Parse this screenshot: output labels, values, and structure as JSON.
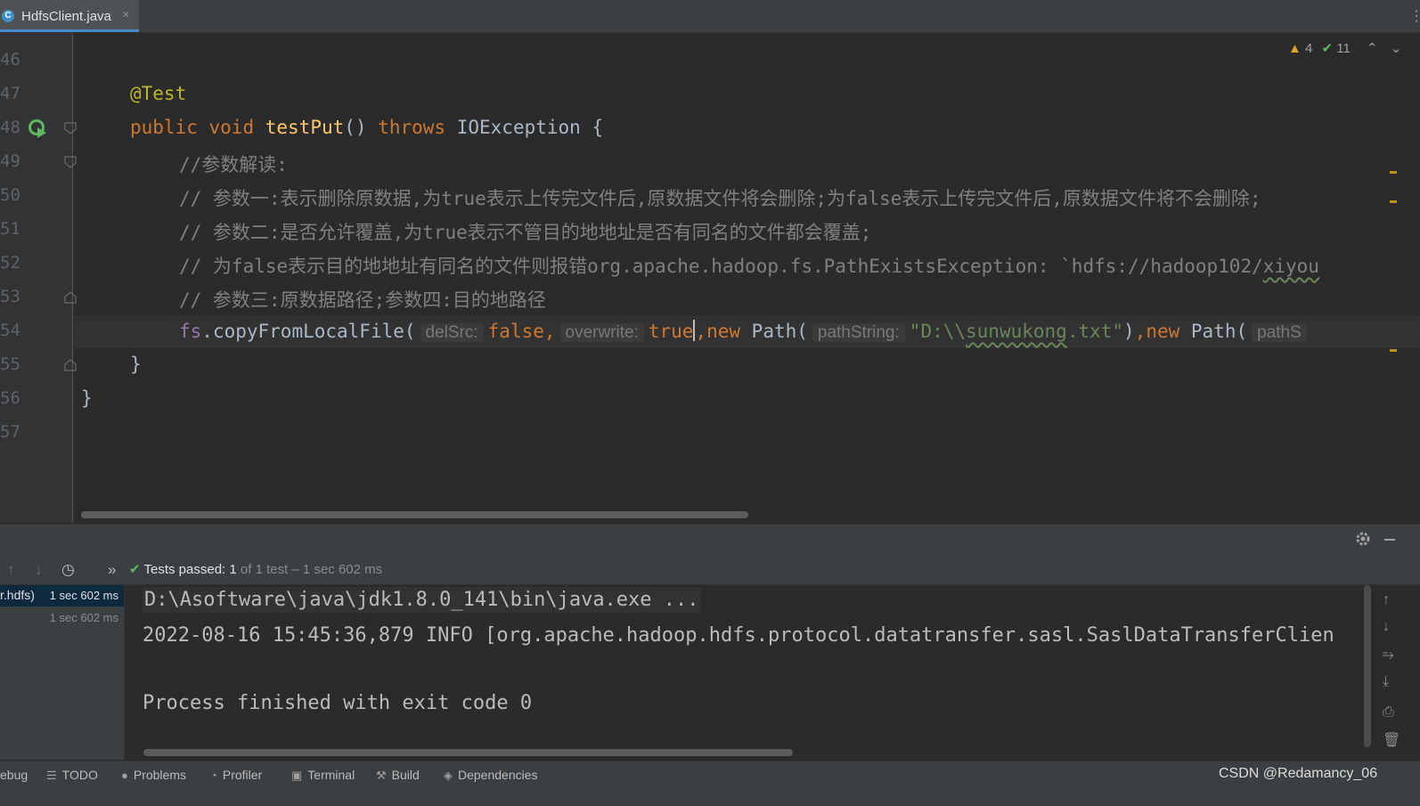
{
  "tab": {
    "filename": "HdfsClient.java",
    "icon_letter": "C",
    "close": "×"
  },
  "inspections": {
    "warnings": "4",
    "passed": "11"
  },
  "line_numbers": [
    "46",
    "47",
    "48",
    "49",
    "50",
    "51",
    "52",
    "53",
    "54",
    "55",
    "56",
    "57"
  ],
  "code": {
    "annotation": "@Test",
    "public": "public",
    "void": "void",
    "method_name": "testPut",
    "parens": "()",
    "throws": "throws",
    "exception": "IOException",
    "open_brace": "{",
    "comment_1": "//参数解读:",
    "comment_2": "// 参数一:表示删除原数据,为true表示上传完文件后,原数据文件将会删除;为false表示上传完文件后,原数据文件将不会删除;",
    "comment_3": "// 参数二:是否允许覆盖,为true表示不管目的地地址是否有同名的文件都会覆盖;",
    "comment_4": "// 为false表示目的地地址有同名的文件则报错org.apache.hadoop.fs.PathExistsException: `hdfs://hadoop102/",
    "comment_4_tail": "xiyou",
    "comment_5": "// 参数三:原数据路径;参数四:目的地路径",
    "call_obj": "fs",
    "call_method": ".copyFromLocalFile(",
    "hint_delsrc": "delSrc:",
    "val_false": "false,",
    "hint_overwrite": "overwrite:",
    "val_true": "true",
    "comma_new": ",new",
    "path_class": " Path(",
    "hint_pathstring": "pathString:",
    "str_prefix": "\"D:\\\\",
    "str_word": "sunwukong",
    "str_suffix": ".txt\"",
    "close_paren": ")",
    "comma_new_2": ",new",
    "path_class_2": " Path(",
    "hint_pathstring_2": "pathS",
    "close_method": "}",
    "close_class": "}"
  },
  "run_panel": {
    "tests_passed_label": "Tests passed:",
    "tests_passed_count": "1",
    "tests_passed_detail": "of 1 test – 1 sec 602 ms",
    "tree": [
      {
        "name": "r.hdfs)",
        "time": "1 sec 602 ms"
      },
      {
        "name": "",
        "time": "1 sec 602 ms"
      }
    ],
    "console": [
      "D:\\Asoftware\\java\\jdk1.8.0_141\\bin\\java.exe ...",
      "2022-08-16 15:45:36,879 INFO [org.apache.hadoop.hdfs.protocol.datatransfer.sasl.SaslDataTransferClien",
      "Process finished with exit code 0"
    ]
  },
  "bottom_toolbar": {
    "debug": "ebug",
    "todo": "TODO",
    "problems": "Problems",
    "profiler": "Profiler",
    "terminal": "Terminal",
    "build": "Build",
    "dependencies": "Dependencies"
  },
  "watermark": "CSDN @Redamancy_06",
  "colors": {
    "keyword": "#cc7832",
    "annotation": "#bbb529",
    "method": "#ffc66d",
    "comment": "#808080",
    "string": "#6a8759",
    "success": "#5fb85f",
    "warning": "#e0a526"
  }
}
